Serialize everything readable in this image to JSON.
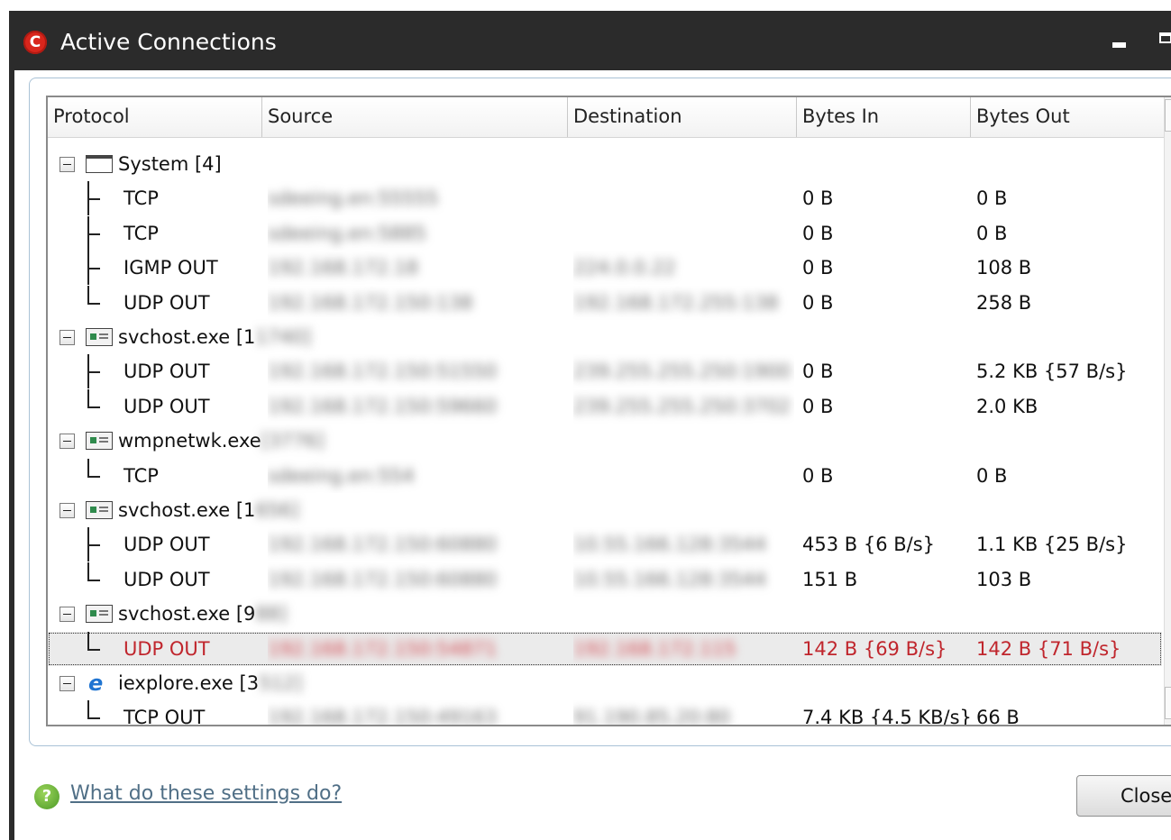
{
  "window": {
    "title": "Active Connections",
    "logo_letter": "C"
  },
  "columns": [
    "Protocol",
    "Source",
    "Destination",
    "Bytes In",
    "Bytes Out"
  ],
  "rows": [
    {
      "kind": "process",
      "icon": "window-icon",
      "name": "System [4]",
      "name_blur": "",
      "source": "",
      "destination": "",
      "bytes_in": "",
      "bytes_out": ""
    },
    {
      "kind": "connection",
      "branch": "tee",
      "protocol": "TCP",
      "source": "sdeeing.en:55555",
      "destination": "",
      "bytes_in": "0 B",
      "bytes_out": "0 B"
    },
    {
      "kind": "connection",
      "branch": "tee",
      "protocol": "TCP",
      "source": "sdeeing.en:5885",
      "destination": "",
      "bytes_in": "0 B",
      "bytes_out": "0 B"
    },
    {
      "kind": "connection",
      "branch": "tee",
      "protocol": "IGMP OUT",
      "source": "192.168.172.18",
      "destination": "224.0.0.22",
      "bytes_in": "0 B",
      "bytes_out": "108 B"
    },
    {
      "kind": "connection",
      "branch": "end",
      "protocol": "UDP OUT",
      "source": "192.168.172.150:138",
      "destination": "192.168.172.255:138",
      "bytes_in": "0 B",
      "bytes_out": "258 B"
    },
    {
      "kind": "process",
      "icon": "service-icon",
      "name": "svchost.exe [1",
      "name_blur": "1740]",
      "source": "",
      "destination": "",
      "bytes_in": "",
      "bytes_out": ""
    },
    {
      "kind": "connection",
      "branch": "tee",
      "protocol": "UDP OUT",
      "source": "192.168.172.150:51550",
      "destination": "239.255.255.250:1900",
      "bytes_in": "0 B",
      "bytes_out": "5.2 KB {57 B/s}"
    },
    {
      "kind": "connection",
      "branch": "end",
      "protocol": "UDP OUT",
      "source": "192.168.172.150:59660",
      "destination": "239.255.255.250:3702",
      "bytes_in": "0 B",
      "bytes_out": "2.0 KB"
    },
    {
      "kind": "process",
      "icon": "service-icon",
      "name": "wmpnetwk.exe",
      "name_blur": "[3776]",
      "source": "",
      "destination": "",
      "bytes_in": "",
      "bytes_out": ""
    },
    {
      "kind": "connection",
      "branch": "end",
      "protocol": "TCP",
      "source": "sdeeing.en:554",
      "destination": "",
      "bytes_in": "0 B",
      "bytes_out": "0 B"
    },
    {
      "kind": "process",
      "icon": "service-icon",
      "name": "svchost.exe [1",
      "name_blur": "656]",
      "source": "",
      "destination": "",
      "bytes_in": "",
      "bytes_out": ""
    },
    {
      "kind": "connection",
      "branch": "tee",
      "protocol": "UDP OUT",
      "source": "192.168.172.150:60880",
      "destination": "10.55.166.128:3544",
      "bytes_in": "453 B {6 B/s}",
      "bytes_out": "1.1 KB {25 B/s}"
    },
    {
      "kind": "connection",
      "branch": "end",
      "protocol": "UDP OUT",
      "source": "192.168.172.150:60880",
      "destination": "10.55.166.128:3544",
      "bytes_in": "151 B",
      "bytes_out": "103 B"
    },
    {
      "kind": "process",
      "icon": "service-icon",
      "name": "svchost.exe [9",
      "name_blur": "88]",
      "source": "",
      "destination": "",
      "bytes_in": "",
      "bytes_out": ""
    },
    {
      "kind": "connection",
      "branch": "end",
      "protocol": "UDP OUT",
      "source": "192.168.172.150:54871",
      "destination": "192.168.172.115",
      "bytes_in": "142 B {69 B/s}",
      "bytes_out": "142 B {71 B/s}",
      "selected": true
    },
    {
      "kind": "process",
      "icon": "ie-icon",
      "name": "iexplore.exe [3",
      "name_blur": "512]",
      "source": "",
      "destination": "",
      "bytes_in": "",
      "bytes_out": ""
    },
    {
      "kind": "connection",
      "branch": "end",
      "protocol": "TCP OUT",
      "source": "192.168.172.150:49163",
      "destination": "91.190.85.20:80",
      "bytes_in": "7.4 KB {4.5 KB/s}",
      "bytes_out": "66 B"
    }
  ],
  "footer": {
    "help_link": "What do these settings do?",
    "close_label": "Close"
  },
  "colors": {
    "titlebar": "#2b2b2b",
    "selected_text": "#c0262d",
    "link": "#506f86"
  }
}
